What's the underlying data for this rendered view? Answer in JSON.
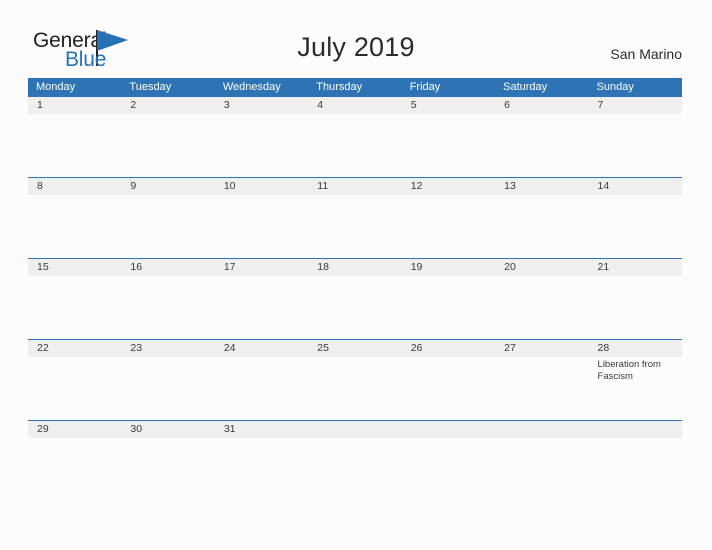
{
  "brand": {
    "name_part1": "General",
    "name_part2": "Blue",
    "flag_icon": "blue-triangle-flag-icon",
    "accent_color": "#2e74b5",
    "dark_color": "#231f20"
  },
  "header": {
    "title": "July 2019",
    "country": "San Marino"
  },
  "calendar": {
    "day_names": [
      "Monday",
      "Tuesday",
      "Wednesday",
      "Thursday",
      "Friday",
      "Saturday",
      "Sunday"
    ],
    "weeks": [
      {
        "days": [
          {
            "num": "1",
            "events": []
          },
          {
            "num": "2",
            "events": []
          },
          {
            "num": "3",
            "events": []
          },
          {
            "num": "4",
            "events": []
          },
          {
            "num": "5",
            "events": []
          },
          {
            "num": "6",
            "events": []
          },
          {
            "num": "7",
            "events": []
          }
        ]
      },
      {
        "days": [
          {
            "num": "8",
            "events": []
          },
          {
            "num": "9",
            "events": []
          },
          {
            "num": "10",
            "events": []
          },
          {
            "num": "11",
            "events": []
          },
          {
            "num": "12",
            "events": []
          },
          {
            "num": "13",
            "events": []
          },
          {
            "num": "14",
            "events": []
          }
        ]
      },
      {
        "days": [
          {
            "num": "15",
            "events": []
          },
          {
            "num": "16",
            "events": []
          },
          {
            "num": "17",
            "events": []
          },
          {
            "num": "18",
            "events": []
          },
          {
            "num": "19",
            "events": []
          },
          {
            "num": "20",
            "events": []
          },
          {
            "num": "21",
            "events": []
          }
        ]
      },
      {
        "days": [
          {
            "num": "22",
            "events": []
          },
          {
            "num": "23",
            "events": []
          },
          {
            "num": "24",
            "events": []
          },
          {
            "num": "25",
            "events": []
          },
          {
            "num": "26",
            "events": []
          },
          {
            "num": "27",
            "events": []
          },
          {
            "num": "28",
            "events": [
              "Liberation from Fascism"
            ]
          }
        ]
      },
      {
        "days": [
          {
            "num": "29",
            "events": []
          },
          {
            "num": "30",
            "events": []
          },
          {
            "num": "31",
            "events": []
          },
          {
            "num": "",
            "events": []
          },
          {
            "num": "",
            "events": []
          },
          {
            "num": "",
            "events": []
          },
          {
            "num": "",
            "events": []
          }
        ]
      }
    ]
  }
}
